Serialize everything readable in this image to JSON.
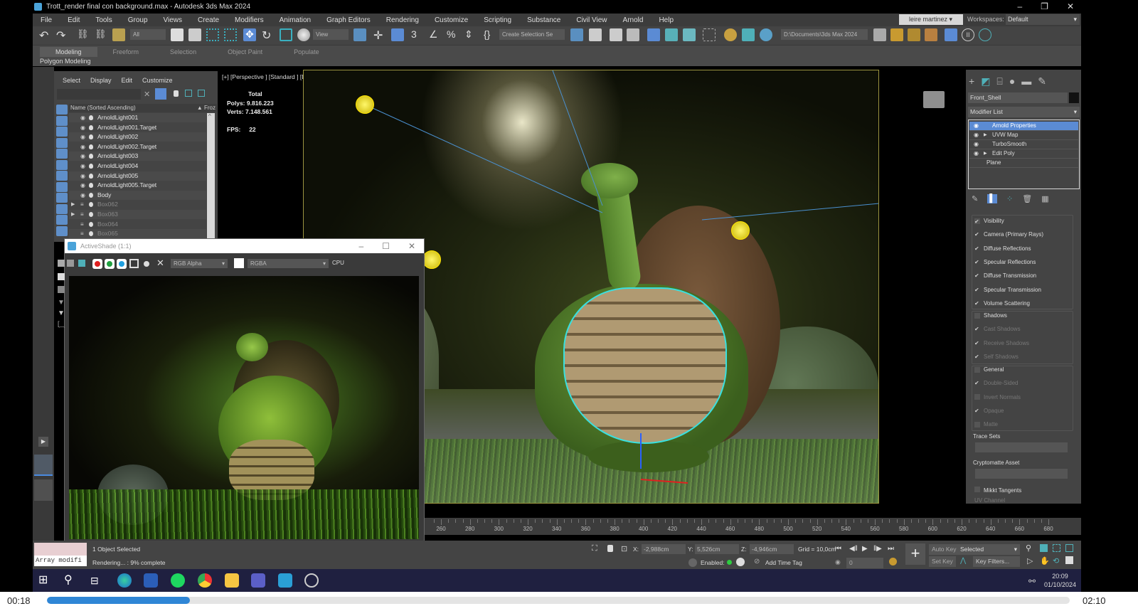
{
  "window": {
    "title": "Trott_render final con background.max - Autodesk 3ds Max 2024",
    "controls": [
      "–",
      "❐",
      "✕"
    ]
  },
  "menu": [
    "File",
    "Edit",
    "Tools",
    "Group",
    "Views",
    "Create",
    "Modifiers",
    "Animation",
    "Graph Editors",
    "Rendering",
    "Customize",
    "Scripting",
    "Substance",
    "Civil View",
    "Arnold",
    "Help"
  ],
  "account": {
    "user": "leire martinez ▾",
    "workspaces_label": "Workspaces:",
    "workspace": "Default"
  },
  "toolbar": {
    "selection_filter": "All",
    "ref_coord": "View",
    "named_selection": "Create Selection Se",
    "project_path": "D:\\Documents\\3ds Max 2024"
  },
  "ribbon": {
    "tabs": [
      "Modeling",
      "Freeform",
      "Selection",
      "Object Paint",
      "Populate"
    ],
    "active_tab": "Modeling",
    "subpanel": "Polygon Modeling"
  },
  "scene_explorer": {
    "menu": [
      "Select",
      "Display",
      "Edit",
      "Customize"
    ],
    "column_header": "Name (Sorted Ascending)",
    "frozen_header": "▲ Froz",
    "items": [
      {
        "name": "ArnoldLight001",
        "type": "light",
        "dim": false
      },
      {
        "name": "ArnoldLight001.Target",
        "type": "light",
        "dim": false
      },
      {
        "name": "ArnoldLight002",
        "type": "light",
        "dim": false
      },
      {
        "name": "ArnoldLight002.Target",
        "type": "light",
        "dim": false
      },
      {
        "name": "ArnoldLight003",
        "type": "light",
        "dim": false
      },
      {
        "name": "ArnoldLight004",
        "type": "light",
        "dim": false
      },
      {
        "name": "ArnoldLight005",
        "type": "light",
        "dim": false
      },
      {
        "name": "ArnoldLight005.Target",
        "type": "light",
        "dim": false
      },
      {
        "name": "Body",
        "type": "geometry",
        "dim": false
      },
      {
        "name": "Box062",
        "type": "geometry",
        "dim": true
      },
      {
        "name": "Box063",
        "type": "geometry",
        "dim": true
      },
      {
        "name": "Box064",
        "type": "geometry",
        "dim": true
      },
      {
        "name": "Box065",
        "type": "geometry",
        "dim": true
      }
    ]
  },
  "viewport": {
    "label": "[+] [Perspective ] [Standard ] [Default Shading ]",
    "stats": {
      "heading": "Total",
      "polys_label": "Polys:",
      "polys": "9.816.223",
      "verts_label": "Verts:",
      "verts": "7.148.561",
      "fps_label": "FPS:",
      "fps": "22"
    }
  },
  "activeshade": {
    "title": "ActiveShade (1:1)",
    "channel": "RGB Alpha",
    "display": "RGBA",
    "device": "CPU"
  },
  "command_panel": {
    "object_name": "Front_Shell",
    "modifier_list": "Modifier List",
    "stack": [
      {
        "name": "Arnold Properties",
        "selected": true,
        "expandable": false,
        "eye": true
      },
      {
        "name": "UVW Map",
        "selected": false,
        "expandable": true,
        "eye": true
      },
      {
        "name": "TurboSmooth",
        "selected": false,
        "expandable": false,
        "eye": true
      },
      {
        "name": "Edit Poly",
        "selected": false,
        "expandable": true,
        "eye": true
      },
      {
        "name": "Plane",
        "selected": false,
        "expandable": false,
        "eye": false
      }
    ],
    "visibility": [
      {
        "label": "Visibility",
        "checked": true,
        "enabled": true
      },
      {
        "label": "Camera (Primary Rays)",
        "checked": true,
        "enabled": true
      },
      {
        "label": "Diffuse Reflections",
        "checked": true,
        "enabled": true
      },
      {
        "label": "Specular Reflections",
        "checked": true,
        "enabled": true
      },
      {
        "label": "Diffuse Transmission",
        "checked": true,
        "enabled": true
      },
      {
        "label": "Specular Transmission",
        "checked": true,
        "enabled": true
      },
      {
        "label": "Volume Scattering",
        "checked": true,
        "enabled": true
      }
    ],
    "shadows": [
      {
        "label": "Shadows",
        "checked": false,
        "enabled": true
      },
      {
        "label": "Cast Shadows",
        "checked": true,
        "enabled": false
      },
      {
        "label": "Receive Shadows",
        "checked": true,
        "enabled": false
      },
      {
        "label": "Self Shadows",
        "checked": true,
        "enabled": false
      }
    ],
    "general": [
      {
        "label": "General",
        "checked": false,
        "enabled": true
      },
      {
        "label": "Double-Sided",
        "checked": true,
        "enabled": false
      },
      {
        "label": "Invert Normals",
        "checked": false,
        "enabled": false
      },
      {
        "label": "Opaque",
        "checked": true,
        "enabled": false
      },
      {
        "label": "Matte",
        "checked": false,
        "enabled": false
      }
    ],
    "trace_sets": "Trace Sets",
    "cryptomatte": "Cryptomatte Asset",
    "mikkt": "Mikkt Tangents",
    "uv_channel": "UV Channel"
  },
  "timeline": {
    "ticks": [
      260,
      280,
      300,
      320,
      340,
      360,
      380,
      400,
      420,
      440,
      460,
      480,
      500,
      520,
      540,
      560,
      580,
      600,
      620,
      640,
      660,
      680
    ]
  },
  "status": {
    "maxscript_output": "Array modifi",
    "selection": "1 Object Selected",
    "prompt": "Rendering... : 9% complete",
    "x_label": "X:",
    "x": "-2,988cm",
    "y_label": "Y:",
    "y": "5,526cm",
    "z_label": "Z:",
    "z": "-4,946cm",
    "grid": "Grid = 10,0cm",
    "enabled_label": "Enabled:",
    "add_time_tag": "Add Time Tag",
    "frame": "0",
    "auto_key": "Auto Key",
    "set_key": "Set Key",
    "key_mode": "Selected",
    "key_filters": "Key Filters..."
  },
  "taskbar": {
    "apps": [
      "start",
      "search",
      "task-view",
      "edge",
      "word",
      "spotify",
      "chrome",
      "file-explorer",
      "teams",
      "3ds-max",
      "obs"
    ],
    "time": "20:09",
    "date": "01/10/2024"
  },
  "player": {
    "elapsed": "00:18",
    "total": "02:10",
    "progress_fraction": 0.14
  },
  "colors": {
    "selection_blue": "#5b8bd4",
    "selection_outline": "#39e0e0",
    "light_gizmo": "#ffe600",
    "taskbar": "#1f2040",
    "player_progress": "#2f86d6"
  }
}
